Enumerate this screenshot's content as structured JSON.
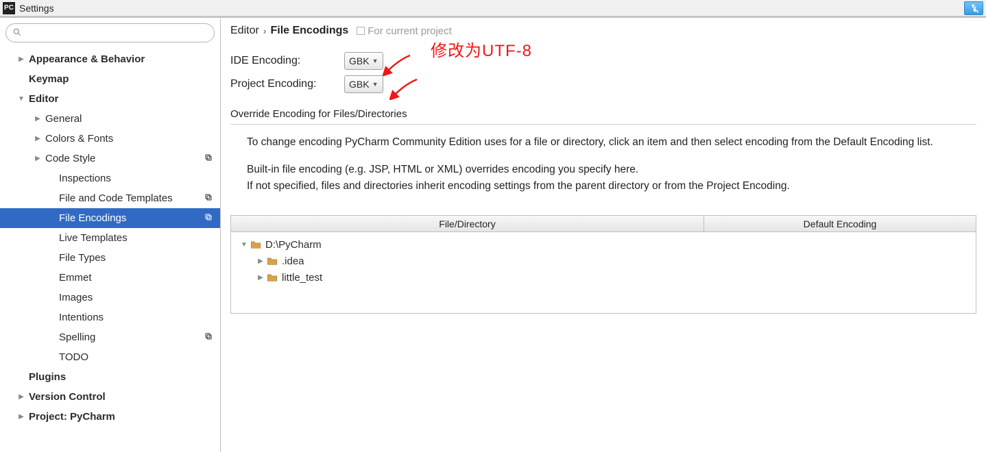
{
  "titlebar": {
    "title": "Settings"
  },
  "sidebar": {
    "search_placeholder": "",
    "items": [
      {
        "label": "Appearance & Behavior",
        "bold": true,
        "level": 0,
        "toggle": "▶",
        "copy": false
      },
      {
        "label": "Keymap",
        "bold": true,
        "level": 0,
        "toggle": "",
        "copy": false
      },
      {
        "label": "Editor",
        "bold": true,
        "level": 0,
        "toggle": "▼",
        "copy": false
      },
      {
        "label": "General",
        "bold": false,
        "level": 1,
        "toggle": "▶",
        "copy": false
      },
      {
        "label": "Colors & Fonts",
        "bold": false,
        "level": 1,
        "toggle": "▶",
        "copy": false
      },
      {
        "label": "Code Style",
        "bold": false,
        "level": 1,
        "toggle": "▶",
        "copy": true
      },
      {
        "label": "Inspections",
        "bold": false,
        "level": 2,
        "toggle": "",
        "copy": false
      },
      {
        "label": "File and Code Templates",
        "bold": false,
        "level": 2,
        "toggle": "",
        "copy": true
      },
      {
        "label": "File Encodings",
        "bold": false,
        "level": 2,
        "toggle": "",
        "copy": true,
        "selected": true
      },
      {
        "label": "Live Templates",
        "bold": false,
        "level": 2,
        "toggle": "",
        "copy": false
      },
      {
        "label": "File Types",
        "bold": false,
        "level": 2,
        "toggle": "",
        "copy": false
      },
      {
        "label": "Emmet",
        "bold": false,
        "level": 2,
        "toggle": "",
        "copy": false
      },
      {
        "label": "Images",
        "bold": false,
        "level": 2,
        "toggle": "",
        "copy": false
      },
      {
        "label": "Intentions",
        "bold": false,
        "level": 2,
        "toggle": "",
        "copy": false
      },
      {
        "label": "Spelling",
        "bold": false,
        "level": 2,
        "toggle": "",
        "copy": true
      },
      {
        "label": "TODO",
        "bold": false,
        "level": 2,
        "toggle": "",
        "copy": false
      },
      {
        "label": "Plugins",
        "bold": true,
        "level": 0,
        "toggle": "",
        "copy": false
      },
      {
        "label": "Version Control",
        "bold": true,
        "level": 0,
        "toggle": "▶",
        "copy": false
      },
      {
        "label": "Project: PyCharm",
        "bold": true,
        "level": 0,
        "toggle": "▶",
        "copy": false
      }
    ]
  },
  "breadcrumb": {
    "parent": "Editor",
    "current": "File Encodings",
    "badge": "For current project"
  },
  "form": {
    "ide_label": "IDE Encoding:",
    "ide_value": "GBK",
    "project_label": "Project Encoding:",
    "project_value": "GBK"
  },
  "annotation": "修改为UTF-8",
  "override": {
    "section_title": "Override Encoding for Files/Directories",
    "desc1": "To change encoding PyCharm Community Edition uses for a file or directory, click an item and then select encoding from the Default Encoding list.",
    "desc2": "Built-in file encoding (e.g. JSP, HTML or XML) overrides encoding you specify here.",
    "desc3": "If not specified, files and directories inherit encoding settings from the parent directory or from the Project Encoding."
  },
  "table": {
    "col1": "File/Directory",
    "col2": "Default Encoding",
    "rows": [
      {
        "name": "D:\\PyCharm",
        "level": 0,
        "toggle": "▼"
      },
      {
        "name": ".idea",
        "level": 1,
        "toggle": "▶"
      },
      {
        "name": "little_test",
        "level": 1,
        "toggle": "▶"
      }
    ]
  }
}
